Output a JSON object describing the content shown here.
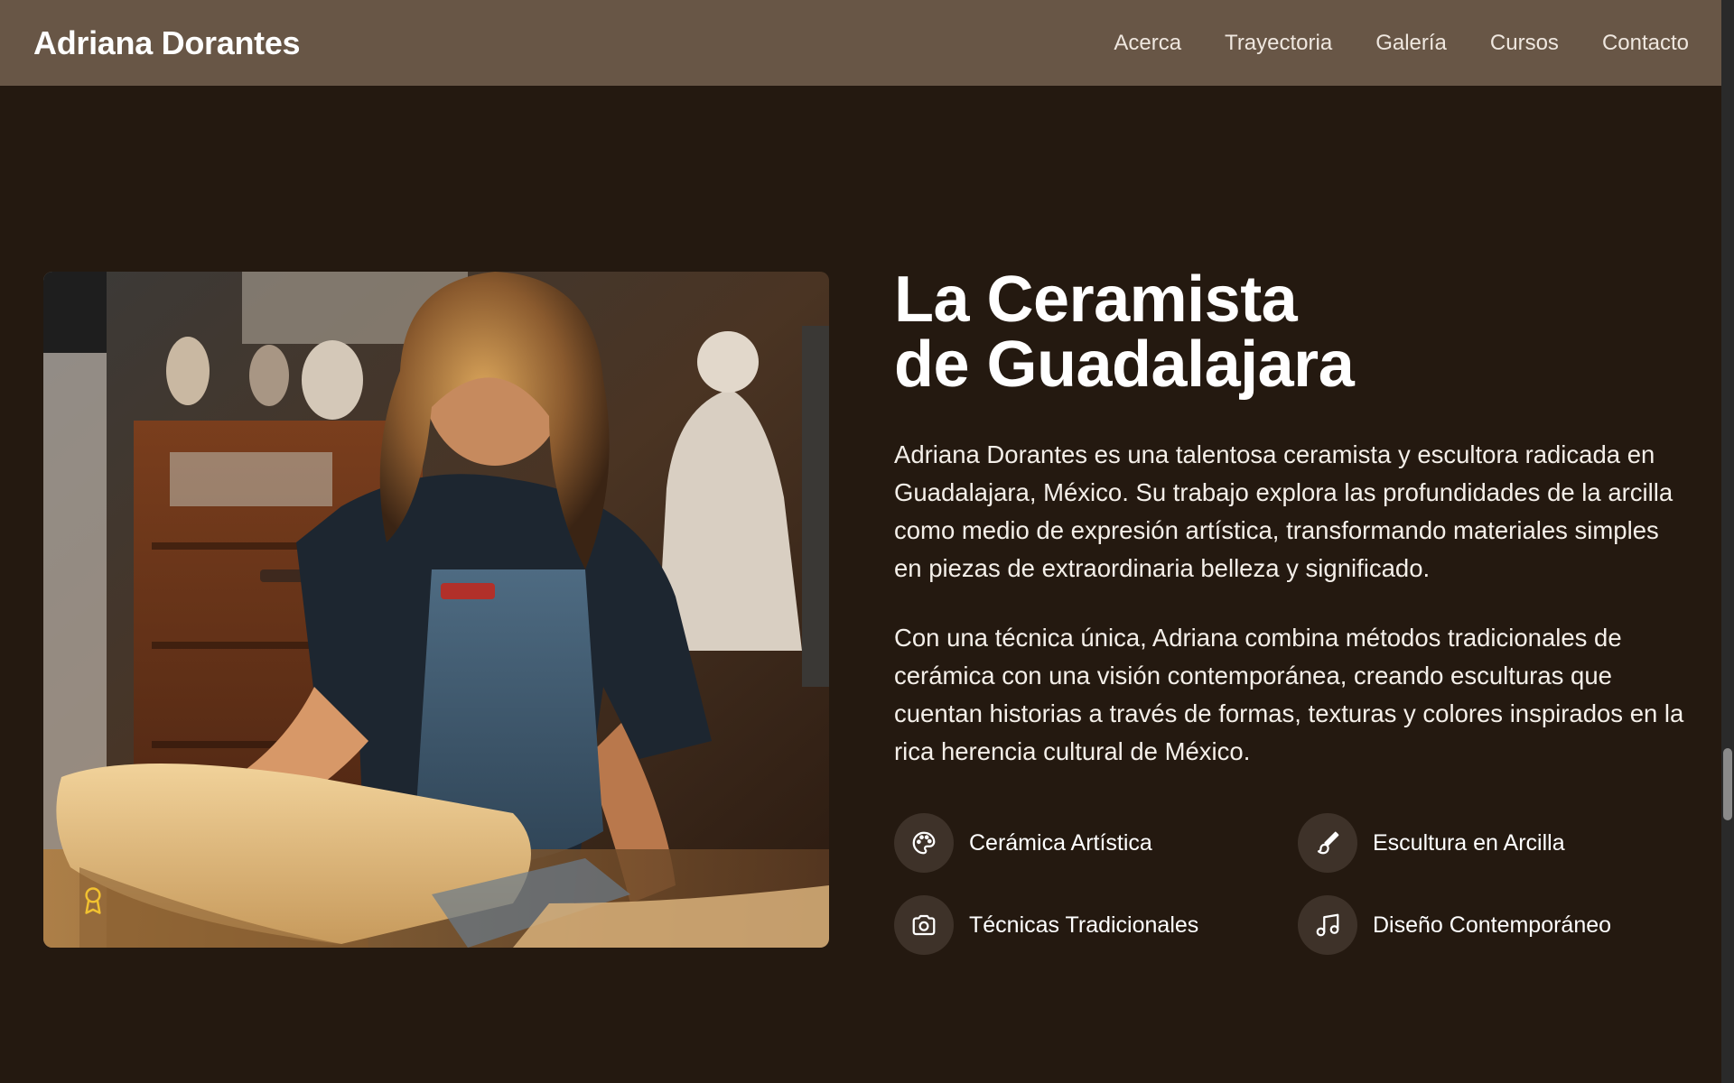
{
  "header": {
    "brand": "Adriana Dorantes",
    "nav": [
      "Acerca",
      "Trayectoria",
      "Galería",
      "Cursos",
      "Contacto"
    ]
  },
  "about": {
    "title_line1": "La Ceramista",
    "title_line2": "de Guadalajara",
    "paragraph1": "Adriana Dorantes es una talentosa ceramista y escultora radicada en Guadalajara, México. Su trabajo explora las profundidades de la arcilla como medio de expresión artística, transformando materiales simples en piezas de extraordinaria belleza y significado.",
    "paragraph2": "Con una técnica única, Adriana combina métodos tradicionales de cerámica con una visión contemporánea, creando esculturas que cuentan historias a través de formas, texturas y colores inspirados en la rica herencia cultural de México.",
    "features": [
      {
        "label": "Cerámica Artística",
        "icon": "palette-icon"
      },
      {
        "label": "Escultura en Arcilla",
        "icon": "brush-icon"
      },
      {
        "label": "Técnicas Tradicionales",
        "icon": "camera-icon"
      },
      {
        "label": "Diseño Contemporáneo",
        "icon": "music-icon"
      }
    ]
  },
  "colors": {
    "background": "#241910",
    "header": "#685646",
    "icon_circle": "#3e3229",
    "award_accent": "#f2c230"
  }
}
